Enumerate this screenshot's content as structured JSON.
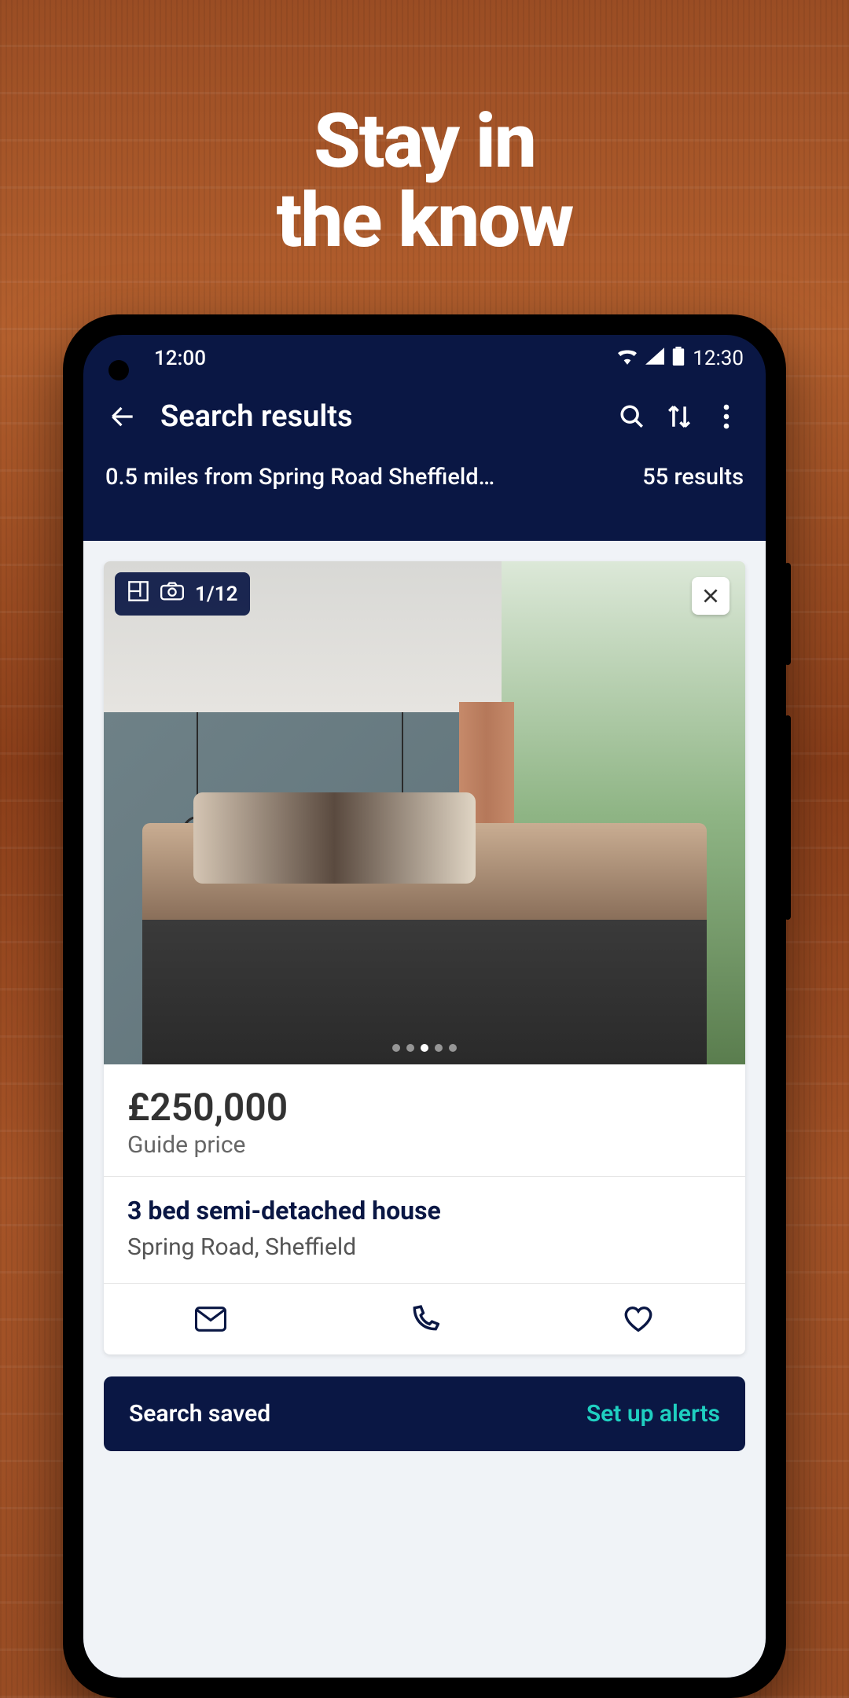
{
  "promo": {
    "line1": "Stay in",
    "line2": "the know"
  },
  "status": {
    "time_left": "12:00",
    "time_right": "12:30"
  },
  "header": {
    "title": "Search results"
  },
  "filter": {
    "location": "0.5 miles from Spring Road Sheffield…",
    "results": "55 results"
  },
  "listing": {
    "photo_counter": "1/12",
    "price": "£250,000",
    "price_label": "Guide price",
    "title": "3 bed semi-detached house",
    "address": "Spring Road, Sheffield"
  },
  "toast": {
    "message": "Search saved",
    "action": "Set up alerts"
  }
}
